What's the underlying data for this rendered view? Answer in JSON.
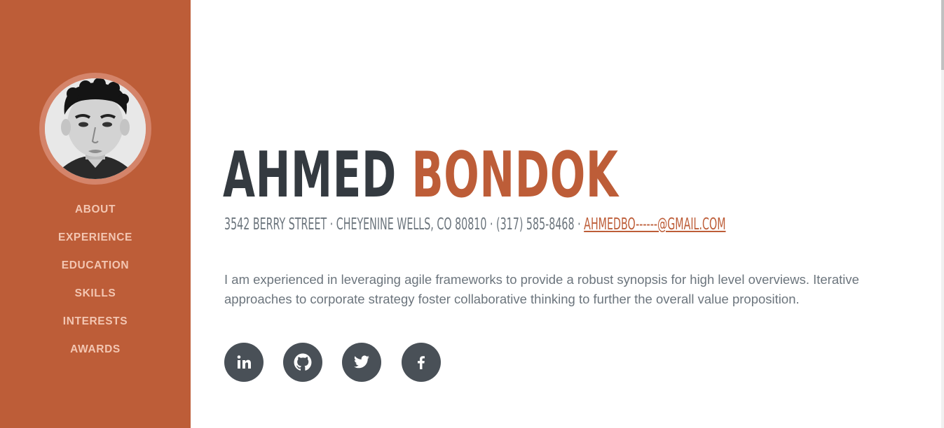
{
  "profile": {
    "first_name": "AHMED",
    "last_name": "BONDOK",
    "address": "3542 BERRY STREET · CHEYENINE WELLS, CO 80810 · (317) 585-8468 · ",
    "email": "AHMEDBO------@GMAIL.COM",
    "bio": "I am experienced in leveraging agile frameworks to provide a robust synopsis for high level overviews. Iterative approaches to corporate strategy foster collaborative thinking to further the overall value proposition."
  },
  "nav": {
    "items": [
      {
        "label": "ABOUT"
      },
      {
        "label": "EXPERIENCE"
      },
      {
        "label": "EDUCATION"
      },
      {
        "label": "SKILLS"
      },
      {
        "label": "INTERESTS"
      },
      {
        "label": "AWARDS"
      }
    ]
  },
  "socials": [
    {
      "icon": "linkedin-icon"
    },
    {
      "icon": "github-icon"
    },
    {
      "icon": "twitter-icon"
    },
    {
      "icon": "facebook-icon"
    }
  ],
  "colors": {
    "sidebar": "#bd5d38",
    "accent": "#bd5d38",
    "heading": "#343a40",
    "text": "#6c757d",
    "icon_bg": "#495057"
  }
}
